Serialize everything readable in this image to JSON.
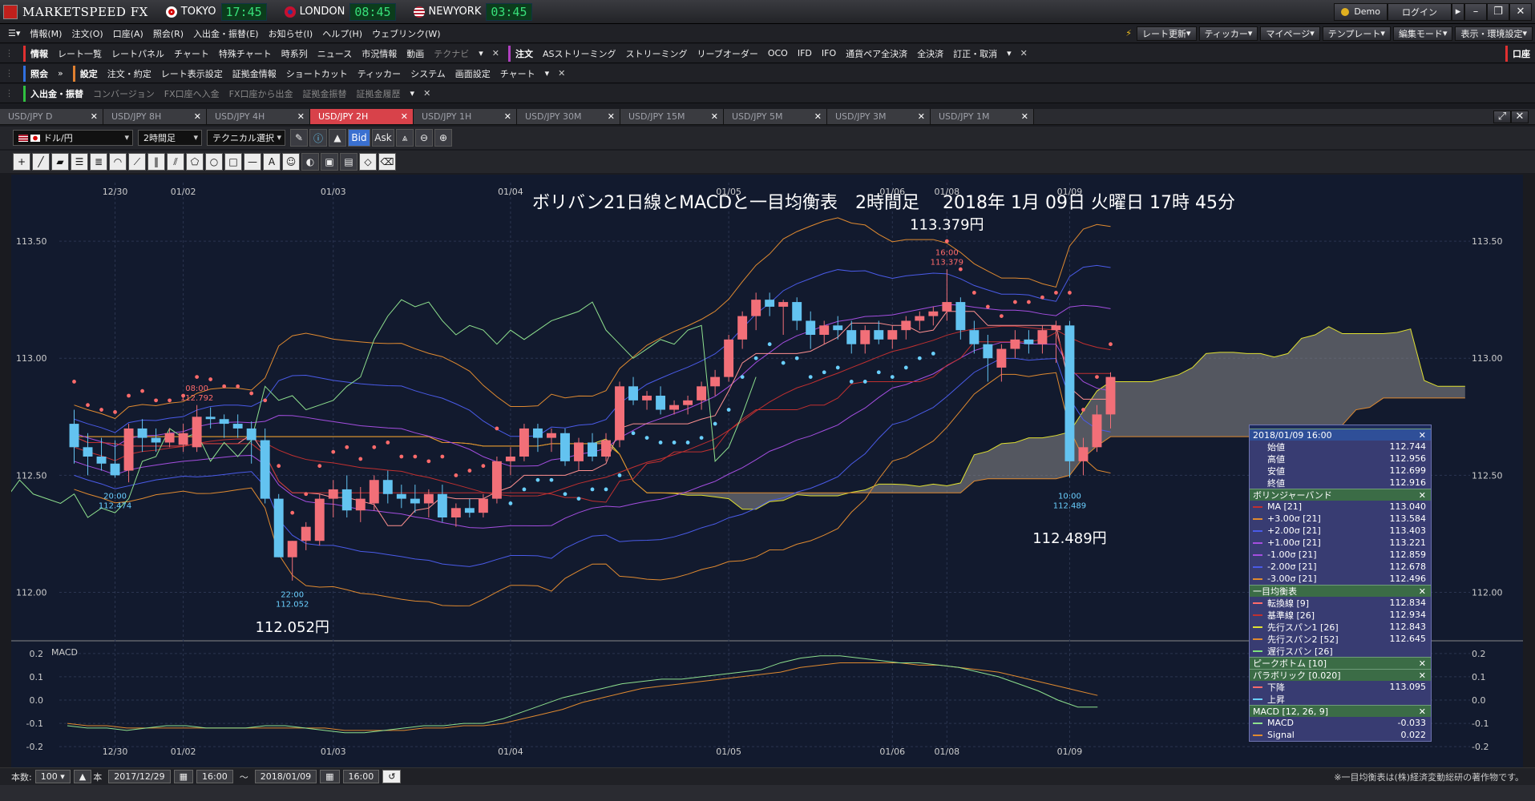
{
  "title": {
    "app": "MARKETSPEED FX",
    "clocks": [
      {
        "city": "TOKYO",
        "time": "17:45",
        "flag": "#ffffff",
        "dot": "#d40000"
      },
      {
        "city": "LONDON",
        "time": "08:45",
        "flag": "#233b8f",
        "dot": "#ffffff"
      },
      {
        "city": "NEWYORK",
        "time": "03:45",
        "flag": "#b22234",
        "dot": "#ffffff"
      }
    ],
    "demo": "Demo",
    "login": "ログイン"
  },
  "menu": {
    "items": [
      "情報(M)",
      "注文(O)",
      "口座(A)",
      "照会(R)",
      "入出金・振替(E)",
      "お知らせ(I)",
      "ヘルプ(H)",
      "ウェブリンク(W)"
    ],
    "right": [
      "レート更新",
      "ティッカー",
      "マイページ",
      "テンプレート",
      "編集モード",
      "表示・環境設定"
    ]
  },
  "toolbar1": {
    "group": "情報",
    "items": [
      "レート一覧",
      "レートパネル",
      "チャート",
      "特殊チャート",
      "時系列",
      "ニュース",
      "市況情報",
      "動画",
      "テクナビ"
    ],
    "group2": "注文",
    "items2": [
      "ASストリーミング",
      "ストリーミング",
      "リーブオーダー",
      "OCO",
      "IFD",
      "IFO",
      "通貨ペア全決済",
      "全決済",
      "訂正・取消"
    ],
    "right": "口座"
  },
  "toolbar2": {
    "group": "照会",
    "group2": "設定",
    "items": [
      "注文・約定",
      "レート表示設定",
      "証拠金情報",
      "ショートカット",
      "ティッカー",
      "システム",
      "画面設定",
      "チャート"
    ]
  },
  "toolbar3": {
    "group": "入出金・振替",
    "items": [
      "コンバージョン",
      "FX口座へ入金",
      "FX口座から出金",
      "証拠金振替",
      "証拠金履歴"
    ]
  },
  "tabs": [
    "USD/JPY D",
    "USD/JPY 8H",
    "USD/JPY 4H",
    "USD/JPY 2H",
    "USD/JPY 1H",
    "USD/JPY 30M",
    "USD/JPY 15M",
    "USD/JPY 5M",
    "USD/JPY 3M",
    "USD/JPY 1M"
  ],
  "active_tab": 3,
  "chart_tools": {
    "pair": "ドル/円",
    "period": "2時間足",
    "technical": "テクニカル選択",
    "bid": "Bid",
    "ask": "Ask"
  },
  "chart_data": {
    "type": "candlestick",
    "title": "ボリバン21日線とMACDと一目均衡表　2時間足　 2018年 1月 09日 火曜日 17時 45分",
    "date_labels": [
      "12/30",
      "01/02",
      "01/03",
      "01/04",
      "01/05",
      "01/06",
      "01/08",
      "01/09"
    ],
    "y_ticks": [
      "113.50",
      "113.00",
      "112.50",
      "112.00"
    ],
    "ylim": [
      111.8,
      113.75
    ],
    "annotations": [
      {
        "time": "08:00",
        "price": "112.792"
      },
      {
        "time": "20:00",
        "price": "112.474"
      },
      {
        "time": "22:00",
        "price": "112.052"
      },
      {
        "time": "16:00",
        "price": "113.379"
      },
      {
        "time": "10:00",
        "price": "112.489"
      }
    ],
    "big_labels": [
      "113.379円",
      "112.052円",
      "112.489円"
    ],
    "candles": [
      [
        112.72,
        112.78,
        112.55,
        112.62
      ],
      [
        112.62,
        112.68,
        112.5,
        112.58
      ],
      [
        112.58,
        112.66,
        112.52,
        112.55
      ],
      [
        112.55,
        112.65,
        112.49,
        112.5
      ],
      [
        112.52,
        112.72,
        112.47,
        112.7
      ],
      [
        112.7,
        112.74,
        112.6,
        112.66
      ],
      [
        112.66,
        112.7,
        112.6,
        112.64
      ],
      [
        112.64,
        112.7,
        112.62,
        112.68
      ],
      [
        112.63,
        112.72,
        112.6,
        112.68
      ],
      [
        112.62,
        112.8,
        112.6,
        112.75
      ],
      [
        112.75,
        112.79,
        112.7,
        112.74
      ],
      [
        112.74,
        112.76,
        112.66,
        112.72
      ],
      [
        112.72,
        112.76,
        112.66,
        112.7
      ],
      [
        112.7,
        112.73,
        112.55,
        112.65
      ],
      [
        112.65,
        112.7,
        112.38,
        112.4
      ],
      [
        112.4,
        112.42,
        112.15,
        112.15
      ],
      [
        112.15,
        112.22,
        112.05,
        112.22
      ],
      [
        112.22,
        112.3,
        112.18,
        112.28
      ],
      [
        112.22,
        112.42,
        112.2,
        112.4
      ],
      [
        112.4,
        112.48,
        112.32,
        112.44
      ],
      [
        112.44,
        112.5,
        112.32,
        112.35
      ],
      [
        112.35,
        112.45,
        112.3,
        112.4
      ],
      [
        112.38,
        112.5,
        112.35,
        112.48
      ],
      [
        112.48,
        112.52,
        112.38,
        112.42
      ],
      [
        112.42,
        112.46,
        112.36,
        112.4
      ],
      [
        112.4,
        112.46,
        112.34,
        112.38
      ],
      [
        112.38,
        112.44,
        112.32,
        112.42
      ],
      [
        112.42,
        112.46,
        112.3,
        112.32
      ],
      [
        112.32,
        112.38,
        112.28,
        112.36
      ],
      [
        112.36,
        112.4,
        112.32,
        112.34
      ],
      [
        112.34,
        112.42,
        112.32,
        112.4
      ],
      [
        112.4,
        112.58,
        112.38,
        112.56
      ],
      [
        112.56,
        112.62,
        112.5,
        112.58
      ],
      [
        112.58,
        112.72,
        112.56,
        112.7
      ],
      [
        112.7,
        112.72,
        112.6,
        112.66
      ],
      [
        112.66,
        112.7,
        112.6,
        112.68
      ],
      [
        112.68,
        112.7,
        112.54,
        112.56
      ],
      [
        112.56,
        112.66,
        112.52,
        112.64
      ],
      [
        112.64,
        112.68,
        112.56,
        112.58
      ],
      [
        112.58,
        112.68,
        112.56,
        112.65
      ],
      [
        112.65,
        112.9,
        112.62,
        112.88
      ],
      [
        112.88,
        112.92,
        112.8,
        112.82
      ],
      [
        112.82,
        112.86,
        112.78,
        112.84
      ],
      [
        112.84,
        112.88,
        112.76,
        112.78
      ],
      [
        112.78,
        112.82,
        112.76,
        112.8
      ],
      [
        112.8,
        112.84,
        112.76,
        112.82
      ],
      [
        112.82,
        112.9,
        112.78,
        112.88
      ],
      [
        112.88,
        112.95,
        112.84,
        112.92
      ],
      [
        112.92,
        113.1,
        112.9,
        113.08
      ],
      [
        113.08,
        113.2,
        113.04,
        113.18
      ],
      [
        113.18,
        113.28,
        113.12,
        113.25
      ],
      [
        113.25,
        113.28,
        113.18,
        113.22
      ],
      [
        113.22,
        113.25,
        113.1,
        113.24
      ],
      [
        113.24,
        113.26,
        113.12,
        113.16
      ],
      [
        113.16,
        113.2,
        113.04,
        113.1
      ],
      [
        113.1,
        113.16,
        113.06,
        113.14
      ],
      [
        113.14,
        113.18,
        113.08,
        113.12
      ],
      [
        113.12,
        113.16,
        113.02,
        113.06
      ],
      [
        113.06,
        113.14,
        113.02,
        113.12
      ],
      [
        113.12,
        113.16,
        113.06,
        113.08
      ],
      [
        113.08,
        113.14,
        113.04,
        113.12
      ],
      [
        113.12,
        113.18,
        113.08,
        113.16
      ],
      [
        113.16,
        113.2,
        113.12,
        113.18
      ],
      [
        113.18,
        113.22,
        113.14,
        113.2
      ],
      [
        113.2,
        113.38,
        113.16,
        113.24
      ],
      [
        113.24,
        113.26,
        113.08,
        113.12
      ],
      [
        113.12,
        113.16,
        113.02,
        113.06
      ],
      [
        113.06,
        113.1,
        112.9,
        113.0
      ],
      [
        112.96,
        113.06,
        112.9,
        113.04
      ],
      [
        113.04,
        113.12,
        113.0,
        113.08
      ],
      [
        113.08,
        113.12,
        113.02,
        113.06
      ],
      [
        113.06,
        113.14,
        113.02,
        113.12
      ],
      [
        113.12,
        113.16,
        112.98,
        113.14
      ],
      [
        113.14,
        113.16,
        112.49,
        112.56
      ],
      [
        112.56,
        112.66,
        112.5,
        112.62
      ],
      [
        112.62,
        112.8,
        112.6,
        112.76
      ],
      [
        112.76,
        112.94,
        112.7,
        112.92
      ]
    ],
    "macd_yticks": [
      "0.2",
      "0.1",
      "0.0",
      "-0.1",
      "-0.2"
    ],
    "macd_ylim": [
      -0.22,
      0.22
    ],
    "macd": [
      -0.11,
      -0.12,
      -0.12,
      -0.13,
      -0.12,
      -0.11,
      -0.11,
      -0.12,
      -0.12,
      -0.12,
      -0.11,
      -0.11,
      -0.12,
      -0.13,
      -0.14,
      -0.14,
      -0.13,
      -0.12,
      -0.11,
      -0.11,
      -0.1,
      -0.1,
      -0.08,
      -0.05,
      -0.02,
      0.01,
      0.03,
      0.05,
      0.07,
      0.08,
      0.09,
      0.09,
      0.1,
      0.11,
      0.12,
      0.13,
      0.16,
      0.18,
      0.19,
      0.19,
      0.18,
      0.17,
      0.16,
      0.16,
      0.15,
      0.14,
      0.12,
      0.1,
      0.07,
      0.04,
      0.0,
      -0.03,
      -0.03
    ],
    "signal": [
      -0.1,
      -0.11,
      -0.11,
      -0.12,
      -0.12,
      -0.12,
      -0.12,
      -0.12,
      -0.12,
      -0.12,
      -0.12,
      -0.12,
      -0.12,
      -0.12,
      -0.13,
      -0.13,
      -0.13,
      -0.13,
      -0.12,
      -0.12,
      -0.11,
      -0.11,
      -0.1,
      -0.08,
      -0.06,
      -0.04,
      -0.01,
      0.01,
      0.03,
      0.05,
      0.06,
      0.07,
      0.08,
      0.09,
      0.1,
      0.11,
      0.12,
      0.14,
      0.15,
      0.16,
      0.16,
      0.16,
      0.16,
      0.15,
      0.15,
      0.14,
      0.13,
      0.12,
      0.1,
      0.08,
      0.06,
      0.04,
      0.02
    ]
  },
  "panel": {
    "date": "2018/01/09 16:00",
    "ohlc": [
      [
        "始値",
        "112.744"
      ],
      [
        "高値",
        "112.956"
      ],
      [
        "安値",
        "112.699"
      ],
      [
        "終値",
        "112.916"
      ]
    ],
    "boll_title": "ボリンジャーバンド",
    "boll": [
      [
        "MA [21]",
        "113.040",
        "#c03030"
      ],
      [
        "+3.00σ [21]",
        "113.584",
        "#e08a30"
      ],
      [
        "+2.00σ [21]",
        "113.403",
        "#4a5be8"
      ],
      [
        "+1.00σ [21]",
        "113.221",
        "#a44ee0"
      ],
      [
        "-1.00σ [21]",
        "112.859",
        "#a44ee0"
      ],
      [
        "-2.00σ [21]",
        "112.678",
        "#4a5be8"
      ],
      [
        "-3.00σ [21]",
        "112.496",
        "#e08a30"
      ]
    ],
    "ichi_title": "一目均衡表",
    "ichi": [
      [
        "転換線 [9]",
        "112.834",
        "#ff6b6b"
      ],
      [
        "基準線 [26]",
        "112.934",
        "#c03030"
      ],
      [
        "先行スパン1 [26]",
        "112.843",
        "#e0e030"
      ],
      [
        "先行スパン2 [52]",
        "112.645",
        "#e08a30"
      ],
      [
        "遅行スパン [26]",
        "",
        "#7ee07e"
      ]
    ],
    "peak_title": "ピークボトム [10]",
    "para_title": "パラボリック [0.020]",
    "para": [
      [
        "下降",
        "113.095",
        "#ff6b6b"
      ],
      [
        "上昇",
        "",
        "#6ad0ff"
      ]
    ],
    "macd_title": "MACD [12, 26, 9]",
    "macd": [
      [
        "MACD",
        "-0.033",
        "#8ee08e"
      ],
      [
        "Signal",
        "0.022",
        "#e08a30"
      ]
    ]
  },
  "status": {
    "count_label": "本数:",
    "count": "100",
    "unit": "本",
    "from_date": "2017/12/29",
    "from_time": "16:00",
    "tilde": "〜",
    "to_date": "2018/01/09",
    "to_time": "16:00",
    "copyright": "※一目均衡表は(株)経済変動総研の著作物です。"
  },
  "colors": {
    "up": "#f26f78",
    "down": "#63c3f0",
    "bg": "#121a2e",
    "cloud": "#888888",
    "accent": "#d8424a"
  }
}
